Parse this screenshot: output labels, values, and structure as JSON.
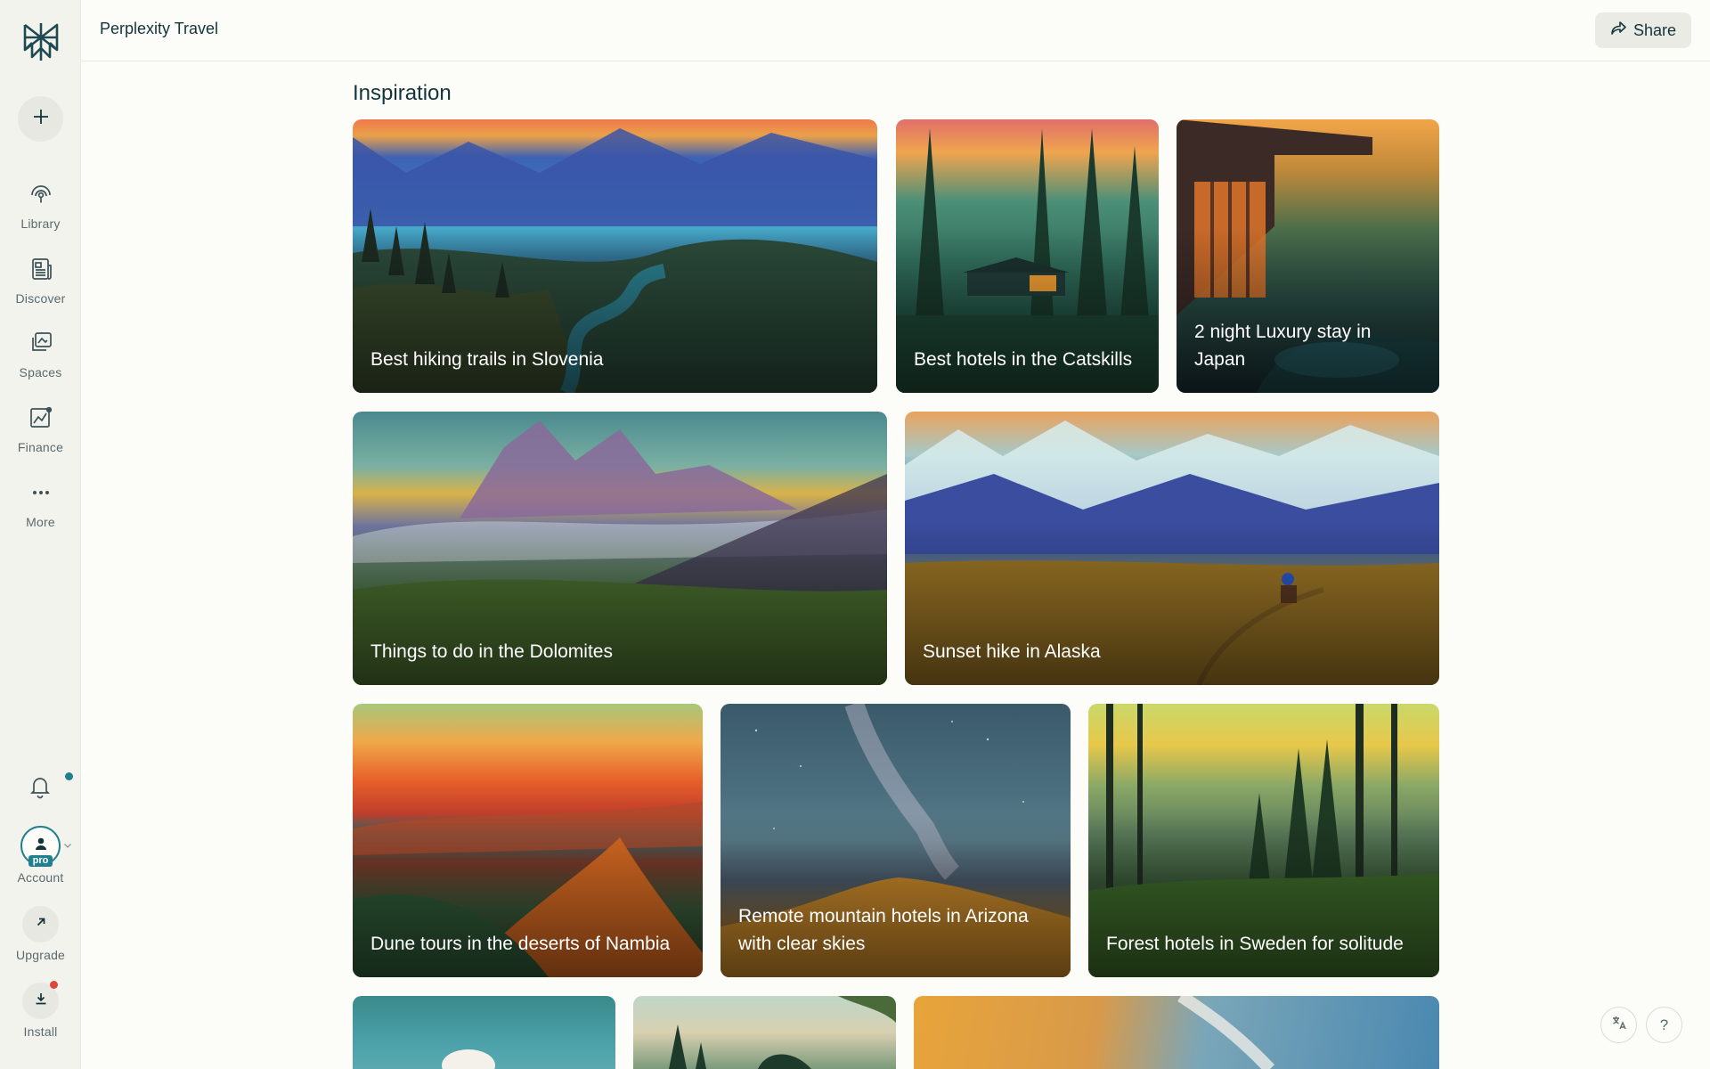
{
  "app": {
    "title": "Perplexity Travel"
  },
  "header": {
    "share_label": "Share",
    "share_icon": "share-icon"
  },
  "sidebar": {
    "new_icon": "plus-icon",
    "items": [
      {
        "label": "Library",
        "icon": "library-icon"
      },
      {
        "label": "Discover",
        "icon": "discover-icon"
      },
      {
        "label": "Spaces",
        "icon": "spaces-icon"
      },
      {
        "label": "Finance",
        "icon": "finance-icon"
      },
      {
        "label": "More",
        "icon": "more-icon"
      }
    ],
    "account": {
      "label": "Account",
      "badge": "pro"
    },
    "upgrade": {
      "label": "Upgrade"
    },
    "install": {
      "label": "Install"
    },
    "colors": {
      "accent": "#20808d",
      "notify": "#20808d",
      "alert": "#e0463a"
    }
  },
  "main": {
    "section_title": "Inspiration",
    "cards": [
      {
        "label": "Best hiking trails in Slovenia"
      },
      {
        "label": "Best hotels in the Catskills"
      },
      {
        "label": "2 night Luxury stay in Japan"
      },
      {
        "label": "Things to do in the Dolomites"
      },
      {
        "label": "Sunset hike in Alaska"
      },
      {
        "label": "Dune tours in the deserts of Nambia"
      },
      {
        "label": "Remote mountain hotels in Arizona with clear skies"
      },
      {
        "label": "Forest hotels in Sweden for solitude"
      },
      {
        "label": ""
      },
      {
        "label": ""
      },
      {
        "label": ""
      }
    ]
  },
  "corner": {
    "translate_icon": "translate-icon",
    "help_label": "?"
  }
}
